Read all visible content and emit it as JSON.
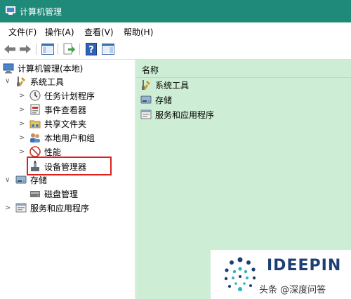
{
  "window": {
    "title": "计算机管理"
  },
  "menu": [
    "文件(F)",
    "操作(A)",
    "查看(V)",
    "帮助(H)"
  ],
  "tree": {
    "root": "计算机管理(本地)",
    "system_tools": "系统工具",
    "task_scheduler": "任务计划程序",
    "event_viewer": "事件查看器",
    "shared_folders": "共享文件夹",
    "local_users": "本地用户和组",
    "performance": "性能",
    "device_manager": "设备管理器",
    "storage": "存储",
    "disk_management": "磁盘管理",
    "services_apps": "服务和应用程序"
  },
  "right": {
    "column_header": "名称",
    "items": [
      "系统工具",
      "存储",
      "服务和应用程序"
    ]
  },
  "watermark": {
    "brand": "IDEEPIN",
    "source": "头条 @深度问答"
  },
  "colors": {
    "titlebar": "#1f8a7a",
    "content_bg": "#cdeed5",
    "highlight": "#e0201c"
  }
}
